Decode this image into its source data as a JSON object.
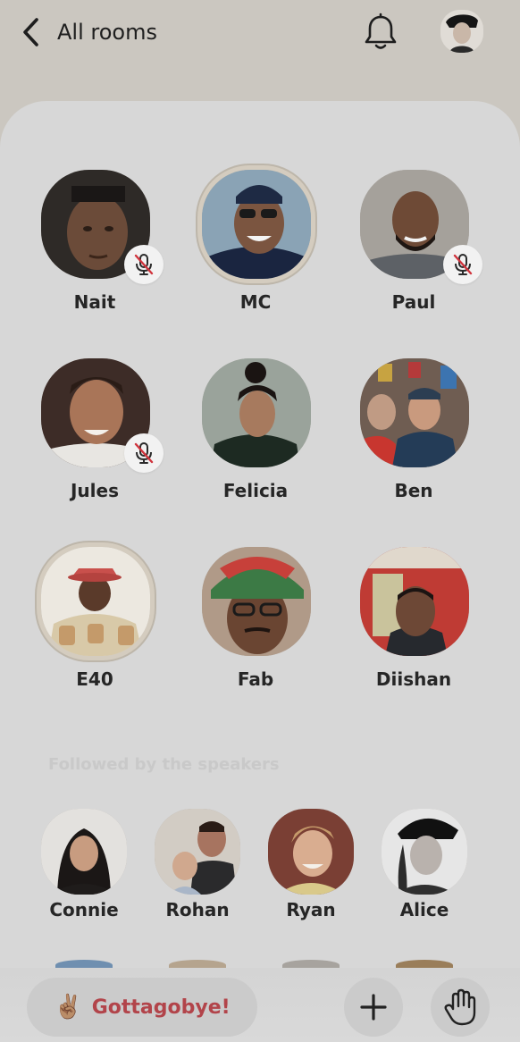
{
  "header": {
    "back_label": "All rooms"
  },
  "speakers": [
    {
      "name": "Nait",
      "muted": true
    },
    {
      "name": "MC",
      "muted": false,
      "speaking": true
    },
    {
      "name": "Paul",
      "muted": true
    },
    {
      "name": "Jules",
      "muted": true
    },
    {
      "name": "Felicia",
      "muted": false
    },
    {
      "name": "Ben",
      "muted": false
    },
    {
      "name": "E40",
      "muted": false,
      "speaking": true
    },
    {
      "name": "Fab",
      "muted": false
    },
    {
      "name": "Diishan",
      "muted": false
    }
  ],
  "followed_section": {
    "label": "Followed by the speakers",
    "listeners": [
      {
        "name": "Connie"
      },
      {
        "name": "Rohan"
      },
      {
        "name": "Ryan"
      },
      {
        "name": "Alice"
      }
    ]
  },
  "actions": {
    "leave_emoji": "✌🏽",
    "leave_label": "Gottagobye!"
  },
  "colors": {
    "leave_text": "#b2444a",
    "panel": "#d7d7d7",
    "top_background": "#cbc7c0"
  }
}
